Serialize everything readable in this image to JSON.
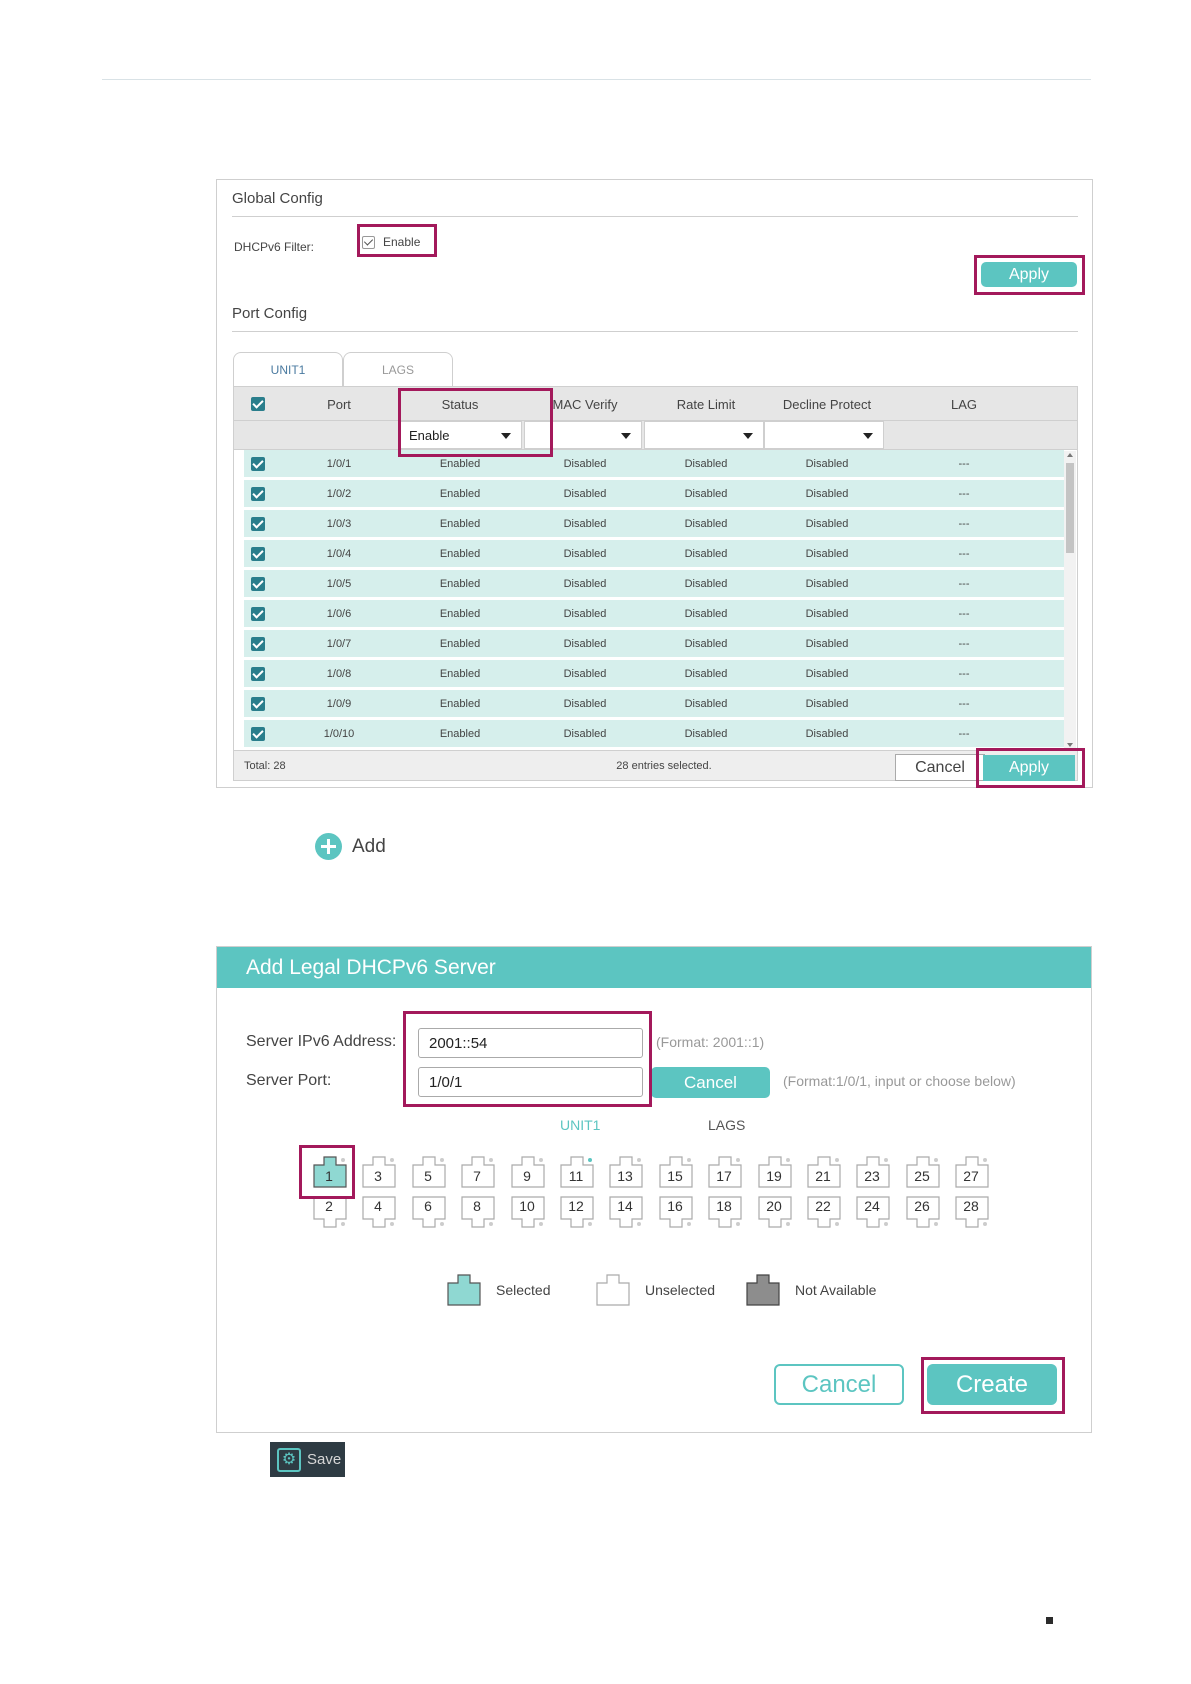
{
  "global_config": {
    "title": "Global Config",
    "dhcpv6_filter_label": "DHCPv6 Filter:",
    "enable_label": "Enable",
    "enabled": true,
    "apply_label": "Apply"
  },
  "port_config": {
    "title": "Port Config",
    "tabs": [
      {
        "label": "UNIT1",
        "active": true
      },
      {
        "label": "LAGS",
        "active": false
      }
    ],
    "columns": [
      "Port",
      "Status",
      "MAC Verify",
      "Rate Limit",
      "Decline Protect",
      "LAG"
    ],
    "filters": {
      "status": "Enable",
      "mac_verify": "",
      "rate_limit": "",
      "decline_protect": ""
    },
    "rows": [
      {
        "port": "1/0/1",
        "status": "Enabled",
        "mac_verify": "Disabled",
        "rate_limit": "Disabled",
        "decline_protect": "Disabled",
        "lag": "---"
      },
      {
        "port": "1/0/2",
        "status": "Enabled",
        "mac_verify": "Disabled",
        "rate_limit": "Disabled",
        "decline_protect": "Disabled",
        "lag": "---"
      },
      {
        "port": "1/0/3",
        "status": "Enabled",
        "mac_verify": "Disabled",
        "rate_limit": "Disabled",
        "decline_protect": "Disabled",
        "lag": "---"
      },
      {
        "port": "1/0/4",
        "status": "Enabled",
        "mac_verify": "Disabled",
        "rate_limit": "Disabled",
        "decline_protect": "Disabled",
        "lag": "---"
      },
      {
        "port": "1/0/5",
        "status": "Enabled",
        "mac_verify": "Disabled",
        "rate_limit": "Disabled",
        "decline_protect": "Disabled",
        "lag": "---"
      },
      {
        "port": "1/0/6",
        "status": "Enabled",
        "mac_verify": "Disabled",
        "rate_limit": "Disabled",
        "decline_protect": "Disabled",
        "lag": "---"
      },
      {
        "port": "1/0/7",
        "status": "Enabled",
        "mac_verify": "Disabled",
        "rate_limit": "Disabled",
        "decline_protect": "Disabled",
        "lag": "---"
      },
      {
        "port": "1/0/8",
        "status": "Enabled",
        "mac_verify": "Disabled",
        "rate_limit": "Disabled",
        "decline_protect": "Disabled",
        "lag": "---"
      },
      {
        "port": "1/0/9",
        "status": "Enabled",
        "mac_verify": "Disabled",
        "rate_limit": "Disabled",
        "decline_protect": "Disabled",
        "lag": "---"
      },
      {
        "port": "1/0/10",
        "status": "Enabled",
        "mac_verify": "Disabled",
        "rate_limit": "Disabled",
        "decline_protect": "Disabled",
        "lag": "---"
      }
    ],
    "total": "Total: 28",
    "selected_text": "28 entries selected.",
    "cancel_label": "Cancel",
    "apply_label": "Apply"
  },
  "add_link": {
    "label": "Add",
    "icon": "plus-circle-icon"
  },
  "dialog": {
    "title": "Add Legal DHCPv6 Server",
    "ipv6_label": "Server IPv6 Address:",
    "ipv6_value": "2001::54",
    "ipv6_hint": "(Format: 2001::1)",
    "port_label": "Server Port:",
    "port_value": "1/0/1",
    "port_hint": "(Format:1/0/1, input or choose below)",
    "cancel_inline_label": "Cancel",
    "unit_tabs": [
      {
        "label": "UNIT1",
        "active": true
      },
      {
        "label": "LAGS",
        "active": false
      }
    ],
    "ports_top": [
      "1",
      "3",
      "5",
      "7",
      "9",
      "11",
      "13",
      "15",
      "17",
      "19",
      "21",
      "23",
      "25",
      "27"
    ],
    "ports_bottom": [
      "2",
      "4",
      "6",
      "8",
      "10",
      "12",
      "14",
      "16",
      "18",
      "20",
      "22",
      "24",
      "26",
      "28"
    ],
    "selected_port": "1",
    "legend": {
      "selected": "Selected",
      "unselected": "Unselected",
      "not_available": "Not Available"
    },
    "cancel_label": "Cancel",
    "create_label": "Create"
  },
  "save": {
    "label": "Save",
    "icon": "gear-icon"
  },
  "colors": {
    "accent": "#5cc5c1",
    "highlight": "#a3195b",
    "row_bg": "#d6efec",
    "checkbox": "#2a7e8c"
  }
}
